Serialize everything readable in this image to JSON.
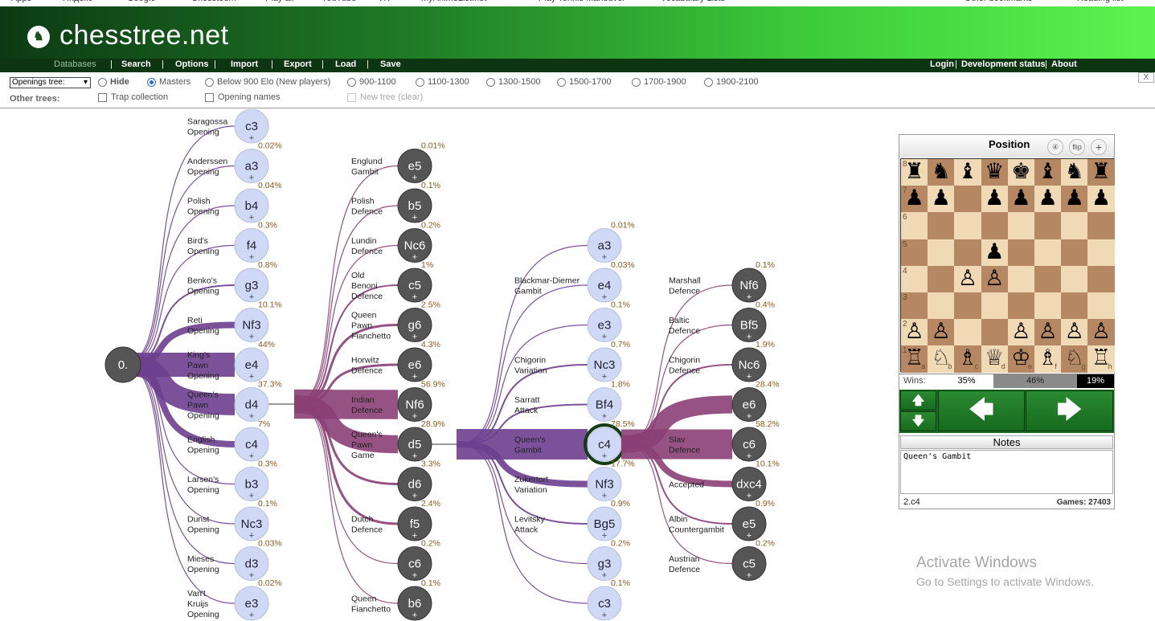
{
  "bookmarks": [
    "Apps",
    "Яндекс",
    "Google",
    "Chessteem",
    "Play air",
    "YouTube",
    "VK",
    "MyAnimeList.net",
    "Play Tennis Maneuver",
    "Vocabulary Lists",
    "Other bookmarks",
    "Reading list"
  ],
  "header": {
    "title": "chesstree.net",
    "logo_glyph": "♞"
  },
  "nav": {
    "left": [
      "Databases",
      "Search",
      "Options",
      "Import",
      "Export",
      "Load",
      "Save"
    ],
    "right": [
      "Login",
      "Development status",
      "About"
    ]
  },
  "options": {
    "tree_select": "Openings tree:",
    "radios": [
      "Hide",
      "Masters",
      "Below 900 Elo (New players)",
      "900-1100",
      "1100-1300",
      "1300-1500",
      "1500-1700",
      "1700-1900",
      "1900-2100"
    ],
    "selected": "Masters",
    "other_label": "Other trees:",
    "checkboxes": [
      "Trap collection",
      "Opening names",
      "New tree (clear)"
    ],
    "close": "X"
  },
  "tree": {
    "root": "0.",
    "col1": [
      {
        "move": "c3",
        "name": [
          "Saragossa",
          "Opening"
        ],
        "pct": "0.01%"
      },
      {
        "move": "a3",
        "name": [
          "Anderssen",
          "Opening"
        ],
        "pct": "0.02%"
      },
      {
        "move": "b4",
        "name": [
          "Polish",
          "Opening"
        ],
        "pct": "0.04%"
      },
      {
        "move": "f4",
        "name": [
          "Bird's",
          "Opening"
        ],
        "pct": "0.3%"
      },
      {
        "move": "g3",
        "name": [
          "Benko's",
          "Opening"
        ],
        "pct": "0.8%"
      },
      {
        "move": "Nf3",
        "name": [
          "Reti",
          "Opening"
        ],
        "pct": "10.1%"
      },
      {
        "move": "e4",
        "name": [
          "King's",
          "Pawn",
          "Opening"
        ],
        "pct": "44%"
      },
      {
        "move": "d4",
        "name": [
          "Queen's",
          "Pawn",
          "Opening"
        ],
        "pct": "37.3%"
      },
      {
        "move": "c4",
        "name": [
          "English",
          "Opening"
        ],
        "pct": "7%"
      },
      {
        "move": "b3",
        "name": [
          "Larsen's",
          "Opening"
        ],
        "pct": "0.3%"
      },
      {
        "move": "Nc3",
        "name": [
          "Dunst",
          "Opening"
        ],
        "pct": "0.1%"
      },
      {
        "move": "d3",
        "name": [
          "Mieses",
          "Opening"
        ],
        "pct": "0.03%"
      },
      {
        "move": "e3",
        "name": [
          "Van't",
          "Kruijs",
          "Opening"
        ],
        "pct": "0.02%"
      }
    ],
    "col2": [
      {
        "move": "e5",
        "name": [
          "Englund",
          "Gambit"
        ],
        "pct": "0.01%"
      },
      {
        "move": "b5",
        "name": [
          "Polish",
          "Defence"
        ],
        "pct": "0.1%"
      },
      {
        "move": "Nc6",
        "name": [
          "Lundin",
          "Defence"
        ],
        "pct": "0.2%"
      },
      {
        "move": "c5",
        "name": [
          "Old",
          "Benoni",
          "Defence"
        ],
        "pct": "1%"
      },
      {
        "move": "g6",
        "name": [
          "Queen",
          "Pawn",
          "Fianchetto"
        ],
        "pct": "2.5%"
      },
      {
        "move": "e6",
        "name": [
          "Horwitz",
          "Defence"
        ],
        "pct": "4.3%"
      },
      {
        "move": "Nf6",
        "name": [
          "Indian",
          "Defence"
        ],
        "pct": "56.9%"
      },
      {
        "move": "d5",
        "name": [
          "Queen's",
          "Pawn",
          "Game"
        ],
        "pct": "28.9%"
      },
      {
        "move": "d6",
        "name": [],
        "pct": "3.3%"
      },
      {
        "move": "f5",
        "name": [
          "Dutch",
          "Defence"
        ],
        "pct": "2.4%"
      },
      {
        "move": "c6",
        "name": [],
        "pct": "0.2%"
      },
      {
        "move": "b6",
        "name": [
          "Queen",
          "Fianchetto"
        ],
        "pct": "0.1%"
      }
    ],
    "col3": [
      {
        "move": "a3",
        "name": [],
        "pct": "0.01%"
      },
      {
        "move": "e4",
        "name": [
          "Blackmar-Diemer",
          "Gambit"
        ],
        "pct": "0.03%"
      },
      {
        "move": "e3",
        "name": [],
        "pct": "0.1%"
      },
      {
        "move": "Nc3",
        "name": [
          "Chigorin",
          "Variation"
        ],
        "pct": "0.7%"
      },
      {
        "move": "Bf4",
        "name": [
          "Sarratt",
          "Attack"
        ],
        "pct": "1.8%"
      },
      {
        "move": "c4",
        "name": [
          "Queen's",
          "Gambit"
        ],
        "pct": "78.5%"
      },
      {
        "move": "Nf3",
        "name": [
          "Zukertort",
          "Variation"
        ],
        "pct": "17.7%"
      },
      {
        "move": "Bg5",
        "name": [
          "Levitsky",
          "Attack"
        ],
        "pct": "0.9%"
      },
      {
        "move": "g3",
        "name": [],
        "pct": "0.2%"
      },
      {
        "move": "c3",
        "name": [],
        "pct": "0.1%"
      }
    ],
    "col4": [
      {
        "move": "Nf6",
        "name": [
          "Marshall",
          "Defence"
        ],
        "pct": "0.1%"
      },
      {
        "move": "Bf5",
        "name": [
          "Baltic",
          "Defence"
        ],
        "pct": "0.4%"
      },
      {
        "move": "Nc6",
        "name": [
          "Chigorin",
          "Defence"
        ],
        "pct": "1.9%"
      },
      {
        "move": "e6",
        "name": [],
        "pct": "28.4%"
      },
      {
        "move": "c6",
        "name": [
          "Slav",
          "Defence"
        ],
        "pct": "58.2%"
      },
      {
        "move": "dxc4",
        "name": [
          "Accepted"
        ],
        "pct": "10.1%"
      },
      {
        "move": "e5",
        "name": [
          "Albin",
          "Countergambit"
        ],
        "pct": "0.9%"
      },
      {
        "move": "c5",
        "name": [
          "Austrian",
          "Defence"
        ],
        "pct": "0.2%"
      }
    ],
    "plus": "+"
  },
  "panel": {
    "title": "Position",
    "buttons": [
      "④",
      "flip",
      "+"
    ],
    "board": [
      "rnbqkbnr",
      "pp.ppppp",
      "........",
      "...p....",
      "..PP....",
      "........",
      "PP..PPPP",
      "RNBQKBNR"
    ],
    "files": [
      "a",
      "b",
      "c",
      "d",
      "e",
      "f",
      "g",
      "h"
    ],
    "wins_label": "Wins:",
    "white_pct": "35%",
    "draw_pct": "46%",
    "black_pct": "19%",
    "notes_header": "Notes",
    "notes_text": "Queen's Gambit",
    "move_text": "2.c4",
    "games_text": "Games: 27403"
  },
  "watermark": {
    "line1": "Activate Windows",
    "line2": "Go to Settings to activate Windows."
  }
}
